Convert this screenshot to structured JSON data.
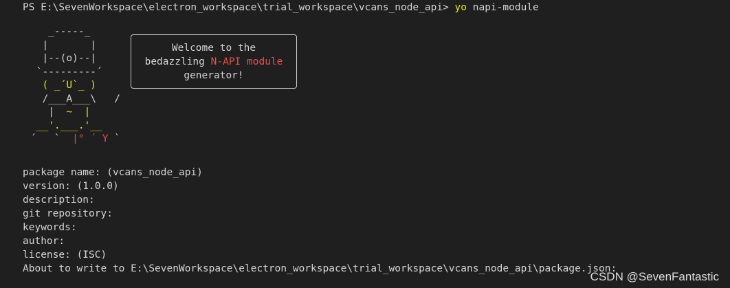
{
  "terminal": {
    "prompt": "PS E:\\SevenWorkspace\\electron_workspace\\trial_workspace\\vcans_node_api> ",
    "command": "yo",
    "command_args": " napi-module",
    "ascii_art": {
      "line1": "   _-----_",
      "line2": "  |       |",
      "line3": "  |--(o)--|",
      "line4": " `---------´",
      "line5": "  ( _´U`_ )",
      "line6": "  /___A___\\   /",
      "line7": "   |  ~  |",
      "line8": " __'.___.'__",
      "line9a": "´   `  ",
      "line9b": "|° ´ Y",
      "line9c": " `"
    },
    "welcome": {
      "line1": "Welcome to the",
      "line2_pre": "bedazzling ",
      "line2_highlight": "N-API module",
      "line3": "generator!"
    },
    "prompts": [
      "package name: (vcans_node_api)",
      "version: (1.0.0)",
      "description:",
      "git repository:",
      "keywords:",
      "author:",
      "license: (ISC)",
      "About to write to E:\\SevenWorkspace\\electron_workspace\\trial_workspace\\vcans_node_api\\package.json:"
    ]
  },
  "watermark": "CSDN @SevenFantastic",
  "colors": {
    "background": "#1f1f1f",
    "text": "#d4d4d4",
    "command": "#e5e510",
    "highlight": "#f14c4c",
    "art_yellow": "#e5e510",
    "art_red": "#f14c4c"
  }
}
